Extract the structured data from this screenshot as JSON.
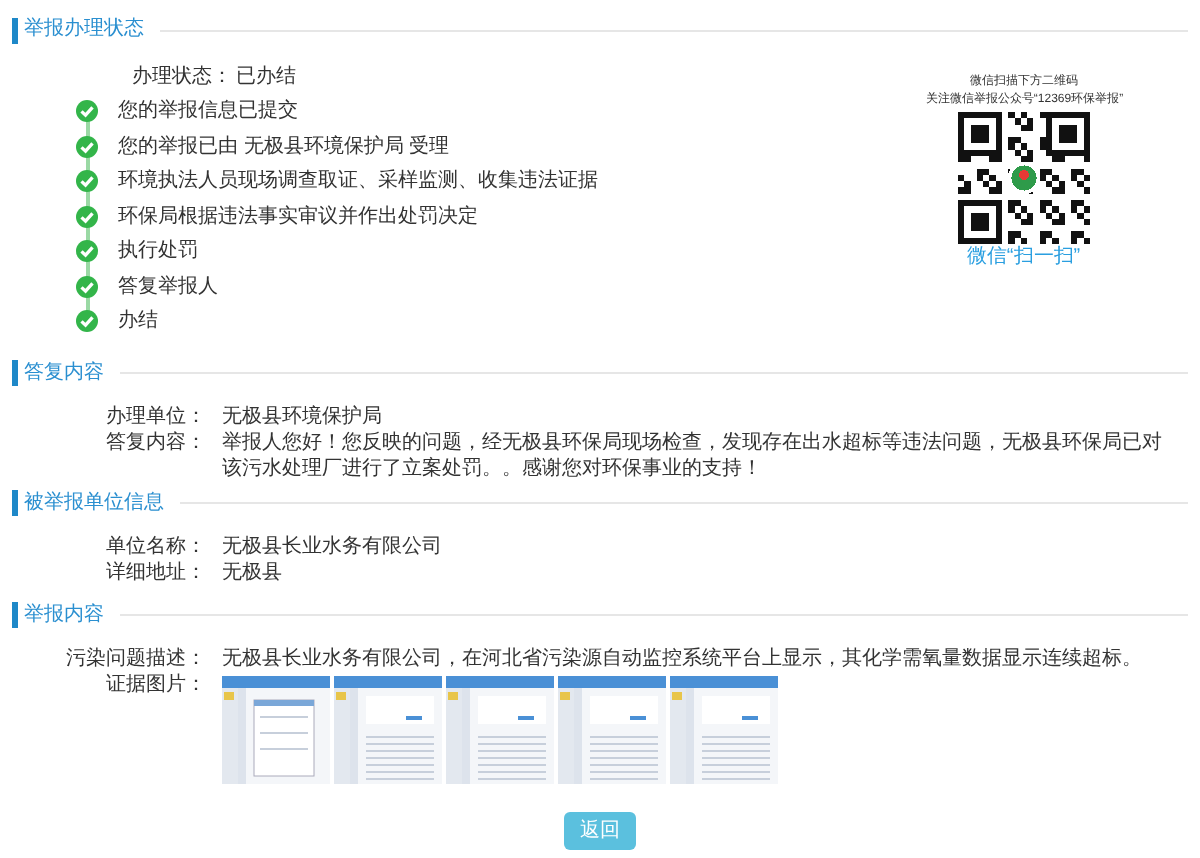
{
  "status_section": {
    "title": "举报办理状态",
    "status_label": "办理状态：",
    "status_value": "已办结",
    "steps": [
      {
        "text": "您的举报信息已提交",
        "done": true
      },
      {
        "text": "您的举报已由 无极县环境保护局 受理",
        "done": true
      },
      {
        "text": "环境执法人员现场调查取证、采样监测、收集违法证据",
        "done": true
      },
      {
        "text": "环保局根据违法事实审议并作出处罚决定",
        "done": true
      },
      {
        "text": "执行处罚",
        "done": true
      },
      {
        "text": "答复举报人",
        "done": true
      },
      {
        "text": "办结",
        "done": true
      }
    ],
    "qr": {
      "caption_lines": [
        "微信扫描下方二维码",
        "关注微信举报公众号“12369环保举报”"
      ],
      "footer": "微信“扫一扫”"
    }
  },
  "reply_section": {
    "title": "答复内容",
    "fields": [
      {
        "label": "办理单位：",
        "value": "无极县环境保护局"
      },
      {
        "label": "答复内容：",
        "value": "举报人您好！您反映的问题，经无极县环保局现场检查，发现存在出水超标等违法问题，无极县环保局已对该污水处理厂进行了立案处罚。。感谢您对环保事业的支持！"
      }
    ]
  },
  "unit_section": {
    "title": "被举报单位信息",
    "fields": [
      {
        "label": "单位名称：",
        "value": "无极县长业水务有限公司"
      },
      {
        "label": "详细地址：",
        "value": "无极县"
      }
    ]
  },
  "report_section": {
    "title": "举报内容",
    "fields": [
      {
        "label": "污染问题描述：",
        "value": "无极县长业水务有限公司，在河北省污染源自动监控系统平台上显示，其化学需氧量数据显示连续超标。"
      }
    ],
    "images_label": "证据图片："
  },
  "back_button": "返回"
}
